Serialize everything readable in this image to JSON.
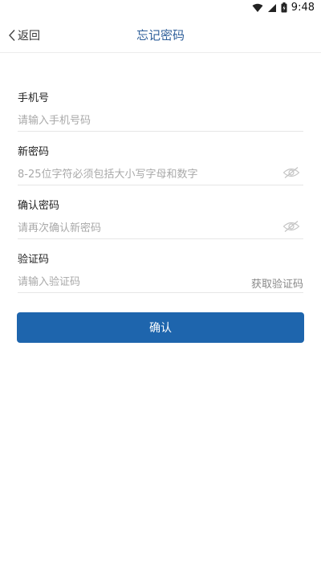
{
  "status_bar": {
    "time": "9:48",
    "icons": [
      "wifi-icon",
      "signal-icon",
      "battery-icon"
    ]
  },
  "nav": {
    "back_label": "返回",
    "title": "忘记密码",
    "title_color": "#2f5f9a"
  },
  "form": {
    "phone": {
      "label": "手机号",
      "placeholder": "请输入手机号码",
      "value": ""
    },
    "new_password": {
      "label": "新密码",
      "placeholder": "8-25位字符必须包括大小写字母和数字",
      "value": "",
      "icon": "eye-off-icon"
    },
    "confirm_password": {
      "label": "确认密码",
      "placeholder": "请再次确认新密码",
      "value": "",
      "icon": "eye-off-icon"
    },
    "verify_code": {
      "label": "验证码",
      "placeholder": "请输入验证码",
      "value": "",
      "action_label": "获取验证码"
    }
  },
  "confirm_button": {
    "label": "确认",
    "color": "#1e65ad"
  }
}
